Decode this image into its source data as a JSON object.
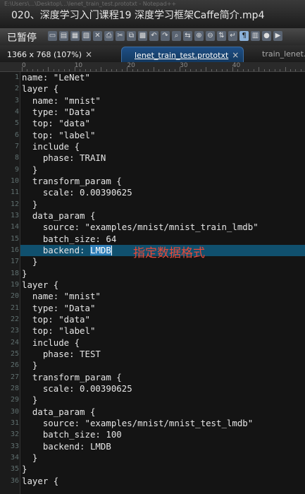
{
  "window": {
    "path": "E:\\Users\\...\\Desktop\\...\\lenet_train_test.prototxt - Notepad++",
    "title": "020、深度学习入门课程19 深度学习框架Caffe简介.mp4"
  },
  "toolbar": {
    "status": "已暂停",
    "icons": [
      "new-file",
      "open-file",
      "save",
      "save-all",
      "close",
      "print",
      "cut",
      "copy",
      "paste",
      "undo",
      "redo",
      "find",
      "replace",
      "zoom-in",
      "zoom-out",
      "sync",
      "wrap",
      "show-all",
      "indent-guide",
      "macro-record",
      "macro-play"
    ],
    "icon_glyphs": [
      "▭",
      "▤",
      "▦",
      "▧",
      "✕",
      "⎙",
      "✂",
      "⧉",
      "▩",
      "↶",
      "↷",
      "⌕",
      "⇆",
      "⊕",
      "⊖",
      "⇅",
      "↵",
      "¶",
      "▥",
      "●",
      "▶"
    ]
  },
  "tabs": {
    "info": "1366 x 768 (107%)",
    "active": "lenet_train_test.prototxt",
    "other": "train_lenet.sh"
  },
  "ruler": [
    "0",
    "10",
    "20",
    "30",
    "40"
  ],
  "code_lines": [
    "name: \"LeNet\"",
    "layer {",
    "  name: \"mnist\"",
    "  type: \"Data\"",
    "  top: \"data\"",
    "  top: \"label\"",
    "  include {",
    "    phase: TRAIN",
    "  }",
    "  transform_param {",
    "    scale: 0.00390625",
    "  }",
    "  data_param {",
    "    source: \"examples/mnist/mnist_train_lmdb\"",
    "    batch_size: 64",
    "    backend: LMDB",
    "  }",
    "}",
    "layer {",
    "  name: \"mnist\"",
    "  type: \"Data\"",
    "  top: \"data\"",
    "  top: \"label\"",
    "  include {",
    "    phase: TEST",
    "  }",
    "  transform_param {",
    "    scale: 0.00390625",
    "  }",
    "  data_param {",
    "    source: \"examples/mnist/mnist_test_lmdb\"",
    "    batch_size: 100",
    "    backend: LMDB",
    "  }",
    "}",
    "layer {"
  ],
  "highlight": {
    "line_number": 16,
    "prefix": "    backend: ",
    "selected": "LMDB"
  },
  "annotation": "指定数据格式",
  "colors": {
    "annotation": "#e84a3a",
    "current_line": "#10506e",
    "active_tab": "#1e4f86"
  }
}
